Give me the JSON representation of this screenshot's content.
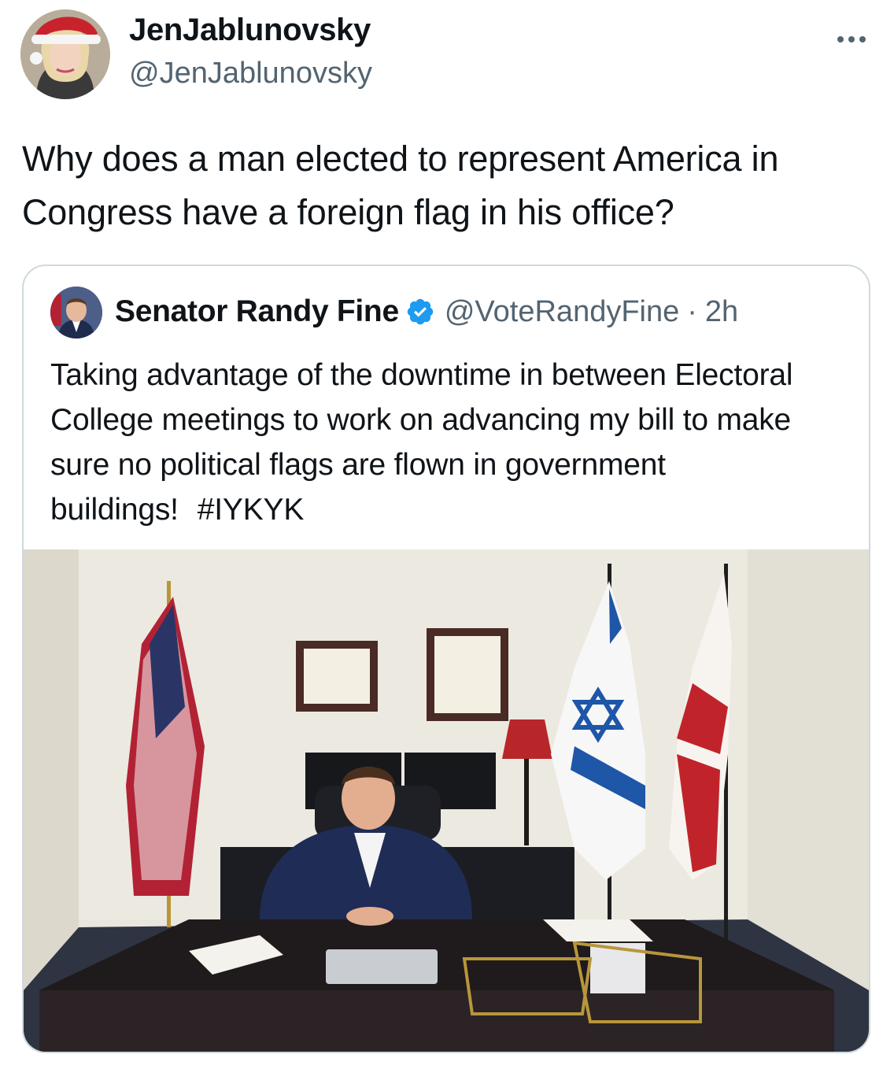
{
  "author": {
    "display_name": "JenJablunovsky",
    "handle": "@JenJablunovsky",
    "avatar_icon": "avatar-santa-hat"
  },
  "more_icon": "more-horizontal-icon",
  "tweet": {
    "text": "Why does a man elected to represent America in Congress have a foreign flag in his office?"
  },
  "quoted_tweet": {
    "display_name": "Senator Randy Fine",
    "verified_icon": "verified-badge-icon",
    "handle": "@VoteRandyFine",
    "separator": "·",
    "time": "2h",
    "text": "Taking advantage of the downtime in between Electoral College meetings to work on advancing my bill to make sure no political flags are flown in government buildings!",
    "hashtag": "#IYKYK",
    "media_description_icon": "office-photo"
  },
  "colors": {
    "secondary_text": "#536471",
    "border": "#cfd9de",
    "verified": "#1d9bf0"
  }
}
